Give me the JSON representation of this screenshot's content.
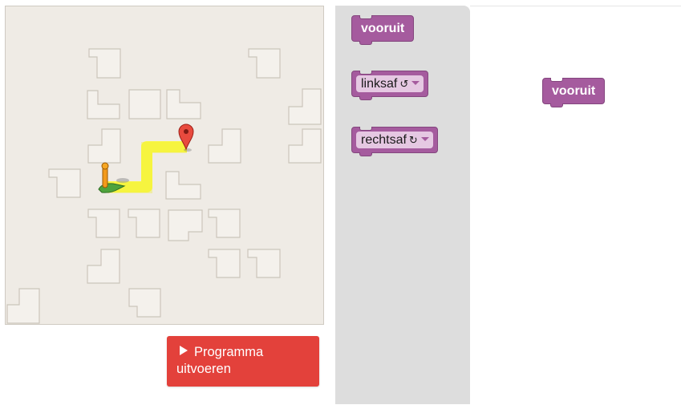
{
  "run_button": {
    "label": "Programma uitvoeren",
    "icon": "play-icon"
  },
  "toolbox": {
    "blocks": [
      {
        "label": "vooruit"
      },
      {
        "label": "linksaf",
        "symbol": "↺"
      },
      {
        "label": "rechtsaf",
        "symbol": "↻"
      }
    ]
  },
  "workspace": {
    "blocks": [
      {
        "label": "vooruit"
      }
    ]
  },
  "colors": {
    "block": "#a55b9e",
    "dropdown": "#e5c8e2",
    "run_button": "#e3413b",
    "path": "#f9f74a",
    "marker": "#e84a3e"
  }
}
